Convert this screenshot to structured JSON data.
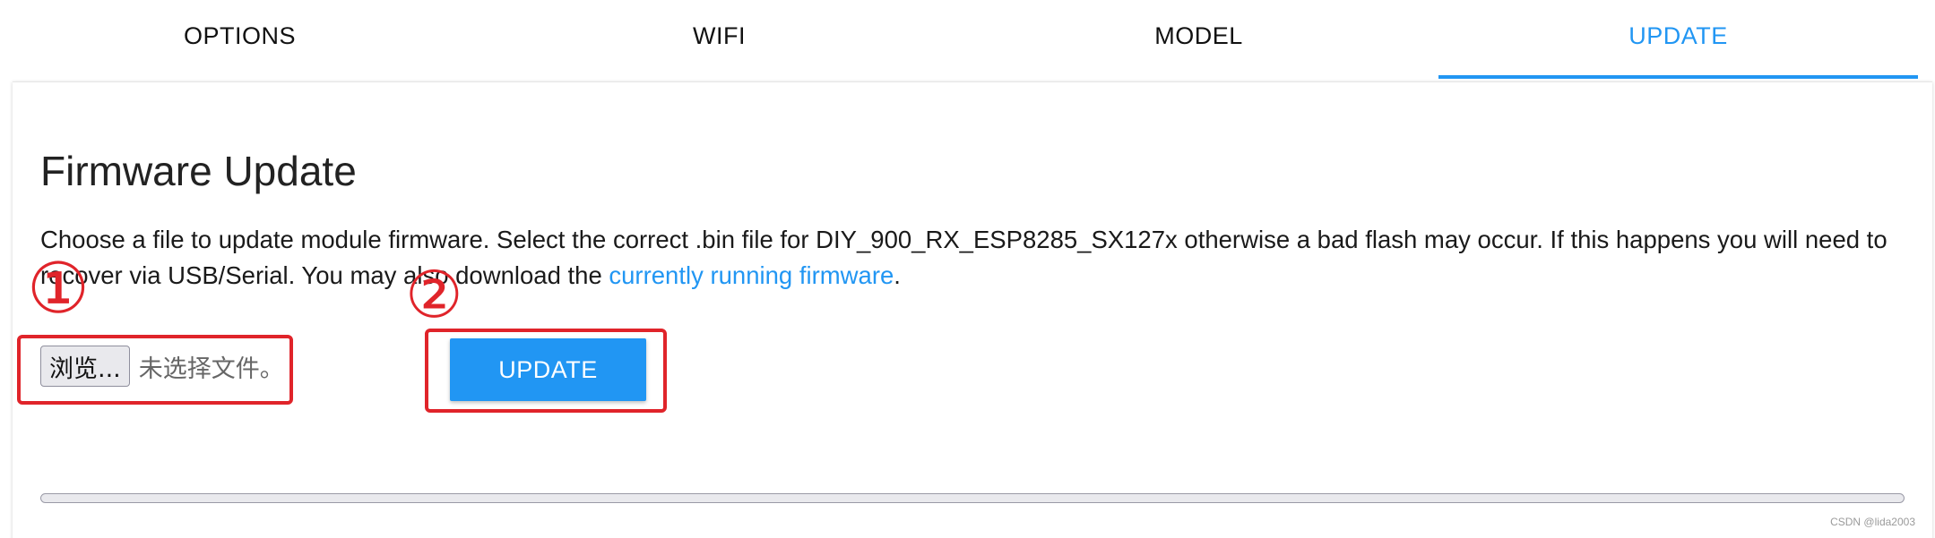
{
  "tabs": [
    {
      "label": "OPTIONS",
      "active": false
    },
    {
      "label": "WIFI",
      "active": false
    },
    {
      "label": "MODEL",
      "active": false
    },
    {
      "label": "UPDATE",
      "active": true
    }
  ],
  "main": {
    "title": "Firmware Update",
    "description_before_link": "Choose a file to update module firmware. Select the correct .bin file for DIY_900_RX_ESP8285_SX127x otherwise a bad flash may occur. If this happens you will need to recover via USB/Serial. You may also download the ",
    "link_text": "currently running firmware",
    "description_after_link": ".",
    "file_input": {
      "button_label": "浏览...",
      "status_text": "未选择文件。"
    },
    "update_button_label": "UPDATE",
    "progress_percent": 0
  },
  "annotations": {
    "marker_1": "①",
    "marker_2": "②",
    "color": "#e0242a"
  },
  "watermark": "CSDN @lida2003",
  "colors": {
    "accent": "#2196f3",
    "annotation_red": "#e0242a"
  }
}
